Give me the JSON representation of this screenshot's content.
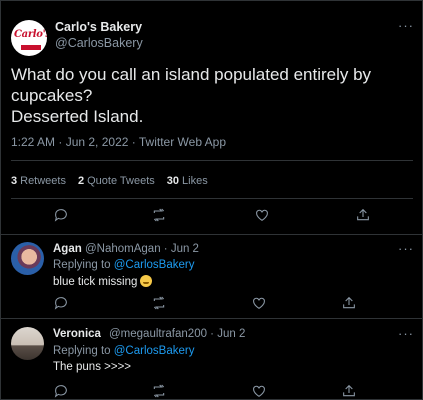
{
  "tweet": {
    "author": {
      "name": "Carlo's Bakery",
      "handle": "@CarlosBakery",
      "logo_text": "Carlo's"
    },
    "text_lines": [
      "What do you call an island populated entirely by",
      "cupcakes?",
      "Desserted Island."
    ],
    "meta": "1:22 AM · Jun 2, 2022 · Twitter Web App",
    "stats": {
      "retweets_count": "3",
      "retweets_label": "Retweets",
      "quotes_count": "2",
      "quotes_label": "Quote Tweets",
      "likes_count": "30",
      "likes_label": "Likes"
    },
    "more_icon": "···"
  },
  "replies": [
    {
      "name": "Agan",
      "handle": "@NahomAgan · Jun 2",
      "replying_prefix": "Replying to",
      "replying_to": "@CarlosBakery",
      "text": "blue tick missing",
      "emoji": "laughing-face",
      "more_icon": "···"
    },
    {
      "name": "Veronica",
      "handle": "@megaultrafan200 · Jun 2",
      "replying_prefix": "Replying to",
      "replying_to": "@CarlosBakery",
      "text": "The puns >>>>",
      "more_icon": "···"
    }
  ],
  "icons": {
    "reply": "reply-icon",
    "retweet": "retweet-icon",
    "like": "heart-icon",
    "share": "share-icon"
  },
  "colors": {
    "background": "#000000",
    "text": "#e7e9ea",
    "secondary_text": "#8b98a5",
    "link": "#1d9bf0",
    "divider": "#2f3336",
    "brand_red": "#c8102e"
  }
}
